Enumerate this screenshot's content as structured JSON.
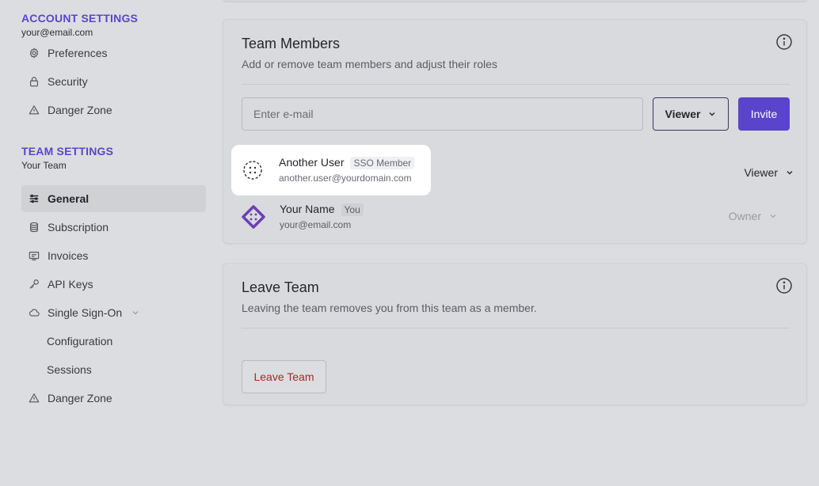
{
  "sidebar": {
    "account": {
      "title": "ACCOUNT SETTINGS",
      "email": "your@email.com",
      "items": [
        {
          "label": "Preferences",
          "icon": "gear-icon"
        },
        {
          "label": "Security",
          "icon": "lock-icon"
        },
        {
          "label": "Danger Zone",
          "icon": "warning-icon"
        }
      ]
    },
    "team": {
      "title": "TEAM SETTINGS",
      "name": "Your Team",
      "items": [
        {
          "label": "General",
          "icon": "sliders-icon",
          "active": true
        },
        {
          "label": "Subscription",
          "icon": "database-icon"
        },
        {
          "label": "Invoices",
          "icon": "invoice-icon"
        },
        {
          "label": "API Keys",
          "icon": "key-icon"
        },
        {
          "label": "Single Sign-On",
          "icon": "cloud-icon"
        },
        {
          "label": "Configuration"
        },
        {
          "label": "Sessions"
        },
        {
          "label": "Danger Zone",
          "icon": "warning-icon"
        }
      ]
    }
  },
  "team_members": {
    "title": "Team Members",
    "description": "Add or remove team members and adjust their roles",
    "email_placeholder": "Enter e-mail",
    "email_value": "",
    "role_select": "Viewer",
    "invite_label": "Invite",
    "members": [
      {
        "name": "Another User",
        "badge": "SSO Member",
        "email": "another.user@yourdomain.com",
        "role": "Viewer"
      },
      {
        "name": "Your Name",
        "badge": "You",
        "email": "your@email.com",
        "role": "Owner"
      }
    ]
  },
  "leave_team": {
    "title": "Leave Team",
    "description": "Leaving the team removes you from this team as a member.",
    "button_label": "Leave Team"
  },
  "colors": {
    "accent": "#5a44cb",
    "danger": "#a42a2a",
    "background": "#dcdde0"
  }
}
